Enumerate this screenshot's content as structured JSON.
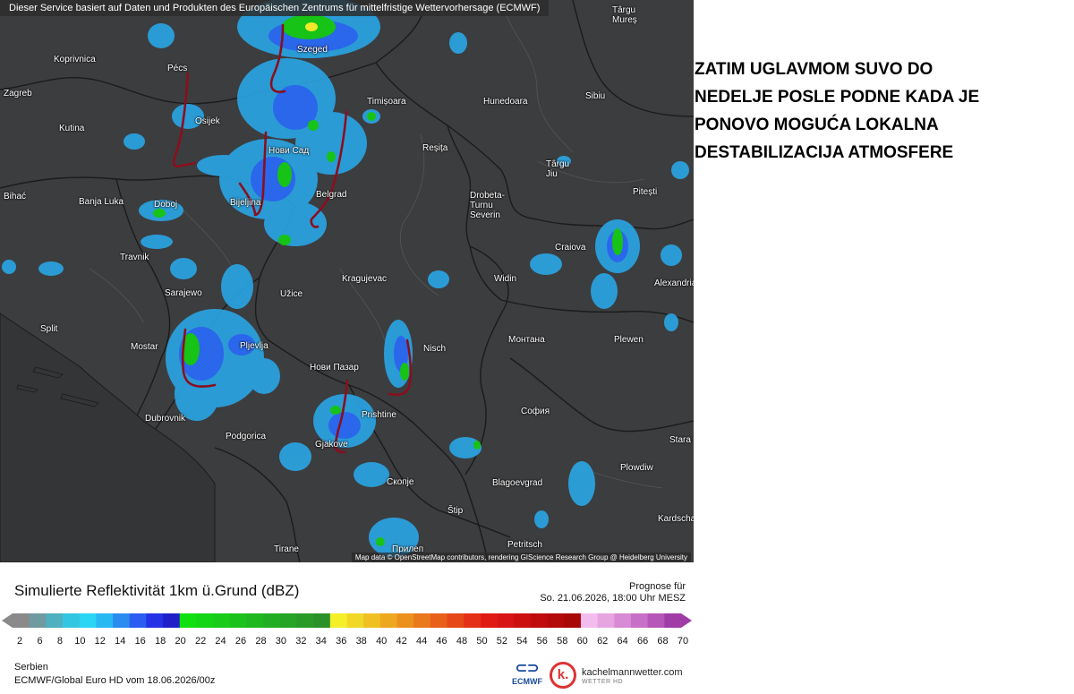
{
  "map": {
    "disclaimer": "Dieser Service basiert auf Daten und Produkten des Europäischen Zentrums für mittelfristige Wettervorhersage (ECMWF)",
    "attribution": "Map data © OpenStreetMap contributors, rendering GIScience Research Group @ Heidelberg University",
    "cities": [
      "Târgu Mureș",
      "Koprivnica",
      "Pécs",
      "Szeged",
      "Zagreb",
      "Timișoara",
      "Hunedoara",
      "Sibiu",
      "Osijek",
      "Kutina",
      "Нови Сад",
      "Reșița",
      "Târgu Jiu",
      "Pitești",
      "Bihać",
      "Banja Luka",
      "Doboj",
      "Bijeljina",
      "Belgrad",
      "Drobeta-Turnu Severin",
      "Craiova",
      "Travnik",
      "Kragujevac",
      "Widin",
      "Alexandria",
      "Sarajewo",
      "Užice",
      "Split",
      "Mostar",
      "Pljevlja",
      "Nisch",
      "Монтана",
      "Plewen",
      "Нови Пазар",
      "Dubrovnik",
      "Prishtine",
      "София",
      "Stara Zagora",
      "Podgorica",
      "Gjakove",
      "Plowdiw",
      "Скопје",
      "Blagoevgrad",
      "Štip",
      "Kardschali",
      "Tirane",
      "Прилеп",
      "Petritsch"
    ]
  },
  "note": {
    "text": "ZATIM UGLAVMOM SUVO DO\nNEDELJE POSLE PODNE KADA JE\nPONOVO MOGUĆA LOKALNA\nDESTABILIZACIJA ATMOSFERE"
  },
  "legend": {
    "title": "Simulierte Reflektivität 1km ü.Grund (dBZ)",
    "forecast_label": "Prognose für",
    "forecast_time": "So. 21.06.2026, 18:00 Uhr MESZ",
    "ticks": [
      2,
      6,
      8,
      10,
      12,
      14,
      16,
      18,
      20,
      22,
      24,
      26,
      28,
      30,
      32,
      34,
      36,
      38,
      40,
      42,
      44,
      46,
      48,
      50,
      52,
      54,
      56,
      58,
      60,
      62,
      64,
      66,
      68,
      70
    ],
    "colors": [
      "#8a8a8a",
      "#6f9aa0",
      "#4fb0c0",
      "#33c6e0",
      "#2ad6f4",
      "#29b9f2",
      "#2a8cef",
      "#2a5ef0",
      "#2532e6",
      "#2020c8",
      "#10e010",
      "#14d614",
      "#18cc18",
      "#1cc21c",
      "#1fb81f",
      "#22ae22",
      "#25a425",
      "#289a28",
      "#2a902a",
      "#f5ef2a",
      "#f2d826",
      "#f0c022",
      "#eea820",
      "#ec901e",
      "#ea781c",
      "#e8601a",
      "#e64818",
      "#e43016",
      "#e01a14",
      "#d81414",
      "#cc1010",
      "#c00c0c",
      "#b40a0a",
      "#a80808",
      "#f2bcee",
      "#e6a4e0",
      "#d88ad4",
      "#c870c8",
      "#b656b8",
      "#a03ca6"
    ],
    "accent_green": "#16c316",
    "accent_blue": "#2a5ef0",
    "annotation_color": "#8a0f1e"
  },
  "footer": {
    "region": "Serbien",
    "model": "ECMWF/Global Euro HD vom  18.06.2026/00z",
    "ecmwf_logo": "ECMWF",
    "brand": "kachelmannwetter.com",
    "brand_sub": "WETTER HD",
    "brand_letter": "k."
  },
  "icons": {
    "ecmwf_symbol": "ecmwf-logo-icon",
    "brand_symbol": "kachelmann-logo-icon"
  }
}
